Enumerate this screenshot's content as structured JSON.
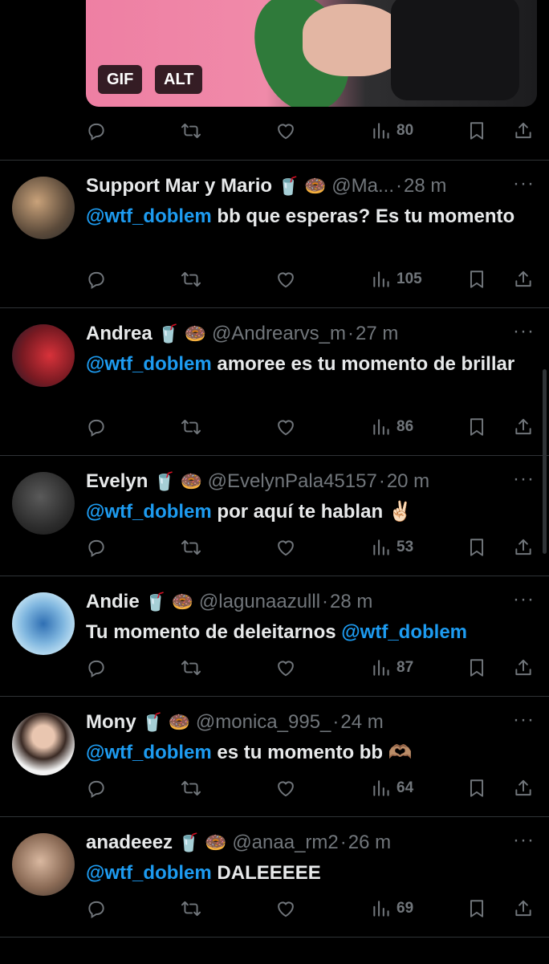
{
  "media": {
    "gif_label": "GIF",
    "alt_label": "ALT"
  },
  "top_actions": {
    "views": "80"
  },
  "tweets": [
    {
      "name": "Support Mar y Mario",
      "emojis": "🥤 🍩",
      "handle": "@Ma...",
      "time": "28 m",
      "mention": "@wtf_doblem",
      "text": "bb que esperas? Es tu momento",
      "views": "105"
    },
    {
      "name": "Andrea",
      "emojis": "🥤 🍩",
      "handle": "@Andrearvs_m",
      "time": "27 m",
      "mention": "@wtf_doblem",
      "text": "amoree es tu momento de brillar",
      "views": "86"
    },
    {
      "name": "Evelyn",
      "emojis": "🥤 🍩",
      "handle": "@EvelynPala45157",
      "time": "20 m",
      "mention": "@wtf_doblem",
      "text": "por aquí te hablan ✌🏻",
      "views": "53"
    },
    {
      "name": "Andie",
      "emojis": "🥤 🍩",
      "handle": "@lagunaazulll",
      "time": "28 m",
      "text_before": "Tu momento de deleitarnos",
      "mention": "@wtf_doblem",
      "views": "87"
    },
    {
      "name": "Mony",
      "emojis": "🥤 🍩",
      "handle": "@monica_995_",
      "time": "24 m",
      "mention": "@wtf_doblem",
      "text": "es tu momento bb 🫶🏽",
      "views": "64"
    },
    {
      "name": "anadeeez",
      "emojis": "🥤 🍩",
      "handle": "@anaa_rm2",
      "time": "26 m",
      "mention": "@wtf_doblem",
      "text": "DALEEEEE",
      "views": "69"
    }
  ],
  "colors": {
    "background": "#000000",
    "text": "#e7e9ea",
    "muted": "#71767b",
    "link": "#1d9bf0",
    "divider": "#2f3336"
  },
  "icons": [
    "reply-icon",
    "retweet-icon",
    "like-icon",
    "views-icon",
    "bookmark-icon",
    "share-icon",
    "more-icon"
  ]
}
